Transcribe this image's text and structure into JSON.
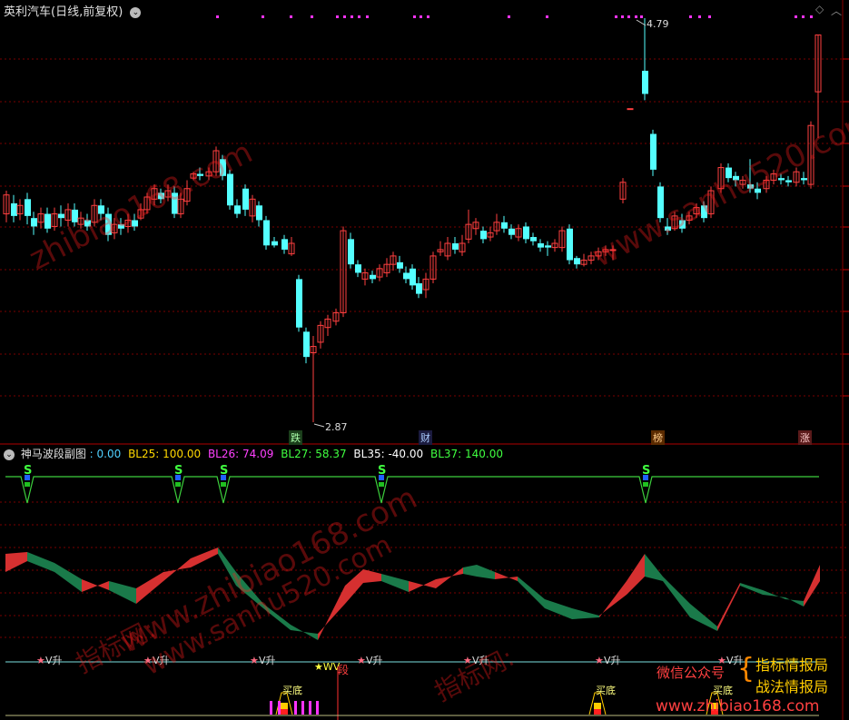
{
  "main_chart": {
    "title": "英利汽车(日线,前复权)",
    "corner_icon": "diamond-icon",
    "high_label": "4.79",
    "low_label": "2.87",
    "markers": [
      "跌",
      "财",
      "榜",
      "涨"
    ],
    "colors": {
      "up": "#ff4040",
      "down": "#54ffff",
      "grid": "#7a0000",
      "marker_dot": "#ff33ff"
    }
  },
  "sub_chart": {
    "title": "神马波段副图",
    "values": [
      {
        "label": ": 0.00",
        "color": "#4fd0ff"
      },
      {
        "label": "BL25: 100.00",
        "color": "#ffd800"
      },
      {
        "label": "BL26: 74.09",
        "color": "#ff40ff"
      },
      {
        "label": "BL27: 58.37",
        "color": "#40ff40"
      },
      {
        "label": "BL35: -40.00",
        "color": "#ffffff"
      },
      {
        "label": "BL37: 140.00",
        "color": "#40ff40"
      }
    ],
    "signal_s": "S",
    "v_label": "V升",
    "wv_label": "WV",
    "duan_label": "段",
    "buy_label": "买底",
    "colors": {
      "bull": "#d63030",
      "bear": "#1a7a4a"
    }
  },
  "watermarks": [
    "zhibiao168.com",
    "www.sanhu520.com",
    "指标网:",
    "www.zhibiao168.com",
    "www.sanhu520.com",
    "指标网:"
  ],
  "wechat": {
    "line1": "微信公众号",
    "line2": "指标情报局",
    "line3": "战法情报局",
    "line4": "www.zhibiao168.com"
  }
}
